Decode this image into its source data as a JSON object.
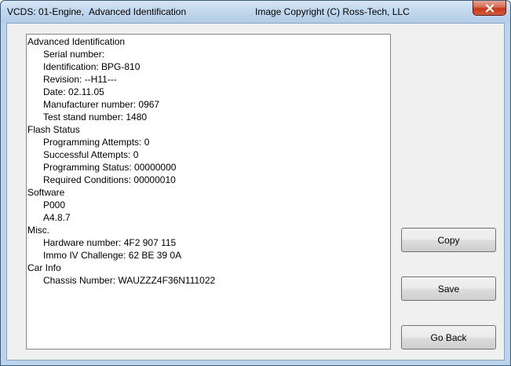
{
  "window": {
    "title_left": "VCDS: 01-Engine,  Advanced Identification",
    "title_right": "Image Copyright (C) Ross-Tech, LLC",
    "close_icon": "close-icon"
  },
  "info": {
    "lines": [
      {
        "text": "Advanced Identification",
        "indent": false
      },
      {
        "text": "Serial number:",
        "indent": true
      },
      {
        "text": "Identification: BPG-810",
        "indent": true
      },
      {
        "text": "Revision: --H11---",
        "indent": true
      },
      {
        "text": "Date: 02.11.05",
        "indent": true
      },
      {
        "text": "Manufacturer number: 0967",
        "indent": true
      },
      {
        "text": "Test stand number: 1480",
        "indent": true
      },
      {
        "text": "Flash Status",
        "indent": false
      },
      {
        "text": "Programming Attempts: 0",
        "indent": true
      },
      {
        "text": "Successful Attempts: 0",
        "indent": true
      },
      {
        "text": "Programming Status: 00000000",
        "indent": true
      },
      {
        "text": "Required Conditions: 00000010",
        "indent": true
      },
      {
        "text": "Software",
        "indent": false
      },
      {
        "text": "P000",
        "indent": true
      },
      {
        "text": "A4.8.7",
        "indent": true
      },
      {
        "text": "Misc.",
        "indent": false
      },
      {
        "text": "Hardware number: 4F2 907 115",
        "indent": true
      },
      {
        "text": "Immo IV Challenge: 62 BE 39 0A",
        "indent": true
      },
      {
        "text": "Car Info",
        "indent": false
      },
      {
        "text": "Chassis Number: WAUZZZ4F36N111022",
        "indent": true
      }
    ]
  },
  "buttons": {
    "copy": "Copy",
    "save": "Save",
    "go_back": "Go Back"
  }
}
